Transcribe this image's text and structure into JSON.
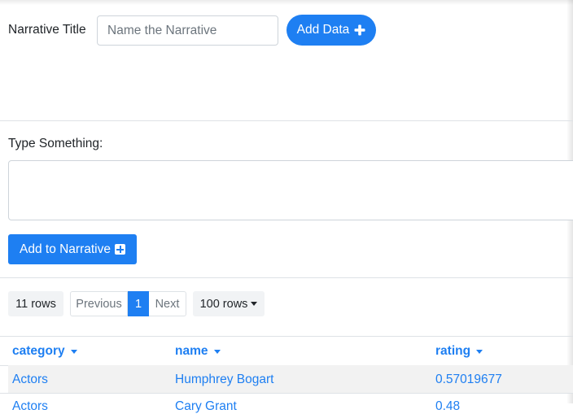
{
  "narrative": {
    "title_label": "Narrative Title",
    "title_placeholder": "Name the Narrative",
    "add_data_label": "Add Data"
  },
  "editor": {
    "prompt_label": "Type Something:",
    "add_to_narrative_label": "Add to Narrative"
  },
  "table_controls": {
    "rows_count": "11 rows",
    "previous_label": "Previous",
    "current_page": "1",
    "next_label": "Next",
    "page_size": "100 rows"
  },
  "table": {
    "columns": [
      "category",
      "name",
      "rating"
    ],
    "rows": [
      [
        "Actors",
        "Humphrey Bogart",
        "0.57019677"
      ],
      [
        "Actors",
        "Cary Grant",
        "0.48"
      ]
    ]
  },
  "colors": {
    "accent": "#1e7ff2",
    "row_stripe": "#f2f2f2",
    "border": "#dee2e6"
  },
  "icons": {
    "add_data": "plus-icon",
    "add_to_narrative": "plus-square-icon",
    "sort": "caret-down-icon"
  }
}
